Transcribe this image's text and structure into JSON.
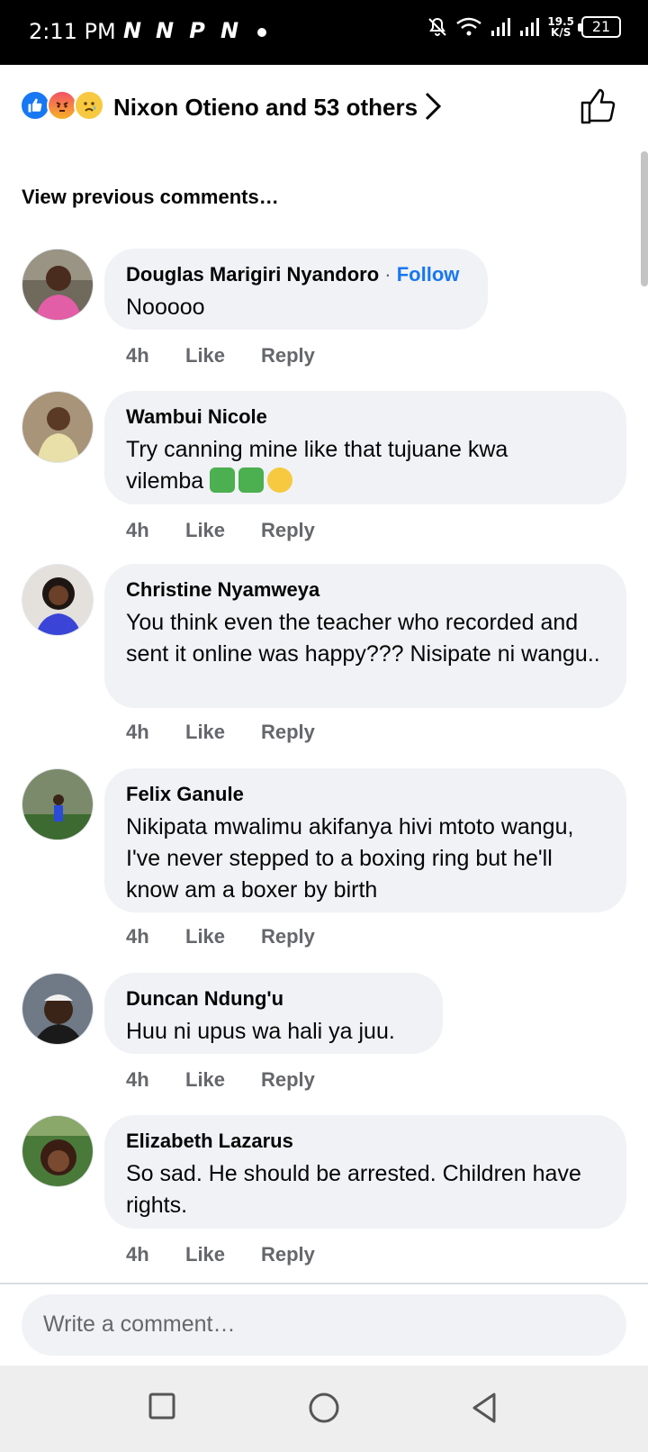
{
  "status_bar": {
    "time": "2:11 PM",
    "notifications": [
      "N",
      "N",
      "P",
      "N"
    ],
    "net_speed_value": "19.5",
    "net_speed_unit": "K/S",
    "battery": "21"
  },
  "reactions": {
    "icons": [
      "like-icon",
      "angry-icon",
      "sad-icon"
    ],
    "label": "Nixon Otieno and 53 others"
  },
  "view_previous": "View previous comments…",
  "comments": [
    {
      "author": "Douglas Marigiri Nyandoro",
      "follow_sep": "·",
      "follow": "Follow",
      "text": "Nooooo",
      "time": "4h",
      "like": "Like",
      "reply": "Reply"
    },
    {
      "author": "Wambui Nicole",
      "text_line1": "Try canning mine like that tujuane kwa",
      "text_line2": "vilemba",
      "time": "4h",
      "like": "Like",
      "reply": "Reply"
    },
    {
      "author": "Christine Nyamweya",
      "text": "You think even the teacher who recorded and sent it online was happy??? Nisipate ni wangu..",
      "time": "4h",
      "like": "Like",
      "reply": "Reply"
    },
    {
      "author": "Felix Ganule",
      "text": "Nikipata mwalimu akifanya hivi mtoto wangu, I've never stepped to a boxing ring but he'll know am a boxer by birth",
      "time": "4h",
      "like": "Like",
      "reply": "Reply"
    },
    {
      "author": "Duncan Ndung'u",
      "text": "Huu ni upus wa hali ya juu.",
      "time": "4h",
      "like": "Like",
      "reply": "Reply"
    },
    {
      "author": "Elizabeth Lazarus",
      "text": "So sad. He should be arrested. Children have rights.",
      "time": "4h",
      "like": "Like",
      "reply": "Reply"
    }
  ],
  "composer": {
    "placeholder": "Write a comment…"
  },
  "nav": {
    "buttons": [
      "recents-square-icon",
      "home-circle-icon",
      "back-triangle-icon"
    ]
  }
}
